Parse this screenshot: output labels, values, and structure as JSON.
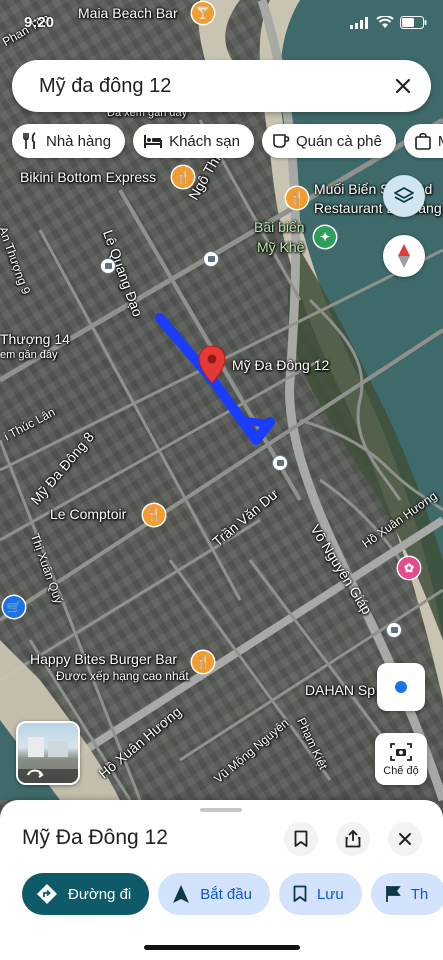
{
  "status": {
    "time": "9:20",
    "colors": {
      "primary": "#0f5a68",
      "route": "#1a3cff",
      "pin": "#e53935"
    }
  },
  "search": {
    "query": "Mỹ đa đông 12"
  },
  "chips": [
    {
      "icon": "restaurant-icon",
      "label": "Nhà hàng"
    },
    {
      "icon": "hotel-icon",
      "label": "Khách sạn"
    },
    {
      "icon": "coffee-icon",
      "label": "Quán cà phê"
    },
    {
      "icon": "shopping-bag-icon",
      "label": "M"
    }
  ],
  "map": {
    "streets": {
      "le_quang_dao": "Lê Quang Đạo",
      "ngo_thi_si": "Ngô Thì Sĩ",
      "an_thuong_9": "An Thượng 9",
      "an_thuong_14": "Thượng 14",
      "thuc_lan": "i Thúc Lân",
      "my_da_dong_8": "Mỹ Đa Đông 8",
      "thi_xuan_quy": "Thị Xuân Quý",
      "tran_van_du": "Trần Văn Dư",
      "vo_nguyen_giap": "Võ Nguyên Giáp",
      "ho_xuan_huong_right": "Hồ Xuân Hương",
      "ho_xuan_huong_left": "Hồ Xuân Hương",
      "vu_mong_nguyen": "Vũ Mộng Nguyên",
      "pham_kiet": "Phạm Kiệt",
      "phan_ton": "Phan Tôn"
    },
    "places": {
      "maia_beach_bar": "Maia Beach Bar",
      "bikini_bottom": "Bikini Bottom Express",
      "muoi_bien_1": "Muối Biển Seafood",
      "muoi_bien_2": "Restaurant Đà Nẵng",
      "bai_bien_1": "Bãi biển",
      "bai_bien_2": "Mỹ Khê",
      "le_comptoir": "Le Comptoir",
      "happy_bites": "Happy Bites Burger Bar",
      "happy_bites_sub": "Được xếp hạng cao nhất",
      "dahan": "DAHAN Sp",
      "xem_gan_day_top": "Đã xem gần đây",
      "xem_gan_day_left": "em gần đây"
    },
    "pin_label": "Mỹ Đa Đông 12"
  },
  "controls": {
    "camera_label": "Chế độ"
  },
  "sheet": {
    "title": "Mỹ Đa Đông 12",
    "actions": [
      {
        "icon": "directions-icon",
        "label": "Đường đi"
      },
      {
        "icon": "navigation-icon",
        "label": "Bắt đầu"
      },
      {
        "icon": "bookmark-icon",
        "label": "Lưu"
      },
      {
        "icon": "flag-icon",
        "label": "Th"
      }
    ]
  }
}
